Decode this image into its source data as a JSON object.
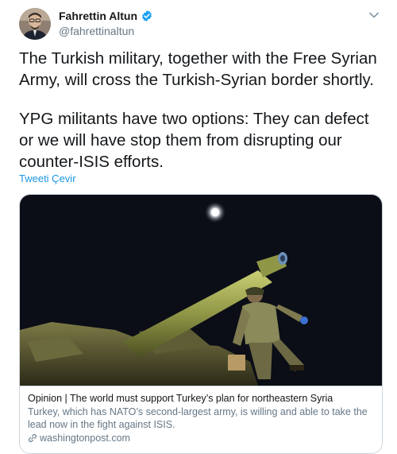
{
  "author": {
    "display_name": "Fahrettin Altun",
    "handle": "@fahrettinaltun",
    "verified": true
  },
  "tweet": {
    "paragraphs": [
      "The Turkish military, together with the Free Syrian Army, will cross the Turkish-Syrian border shortly.",
      "YPG militants have two options: They can defect or we will have stop them from disrupting our counter-ISIS efforts."
    ],
    "translate_label": "Tweeti Çevir"
  },
  "card": {
    "title": "Opinion | The world must support Turkey’s plan for northeastern Syria",
    "description": "Turkey, which has NATO’s second-largest army, is willing and able to take the lead now in the fight against ISIS.",
    "domain": "washingtonpost.com"
  },
  "colors": {
    "accent": "#1b95e0",
    "verified": "#1da1f2",
    "secondary_text": "#657786",
    "border": "#ccd6dd"
  },
  "icons": {
    "verified": "verified-badge-icon",
    "menu": "chevron-down-icon",
    "link": "link-icon"
  }
}
